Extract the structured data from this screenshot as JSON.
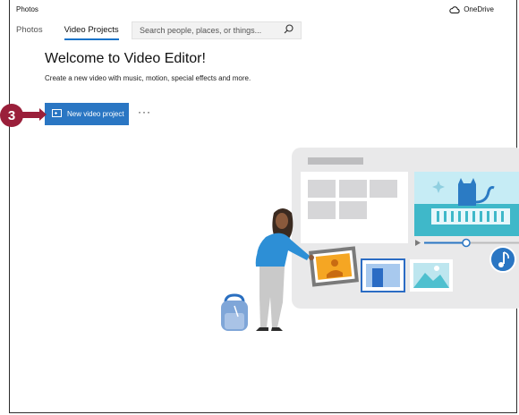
{
  "app": {
    "title": "Photos",
    "onedrive_label": "OneDrive"
  },
  "tabs": [
    {
      "label": "Photos",
      "active": false
    },
    {
      "label": "Video Projects",
      "active": true
    }
  ],
  "search": {
    "placeholder": "Search people, places, or things..."
  },
  "main": {
    "heading": "Welcome to Video Editor!",
    "subheading": "Create a new video with music, motion, special effects and more.",
    "new_project_label": "New video project",
    "more_label": "···"
  },
  "callout": {
    "number": "3"
  },
  "colors": {
    "accent": "#2a76c3",
    "callout": "#9a1f3a",
    "tab_underline": "#1a73c8"
  },
  "icons": {
    "search": "search-icon",
    "onedrive": "cloud-icon",
    "new_project": "video-add-icon",
    "music": "music-note-icon"
  }
}
